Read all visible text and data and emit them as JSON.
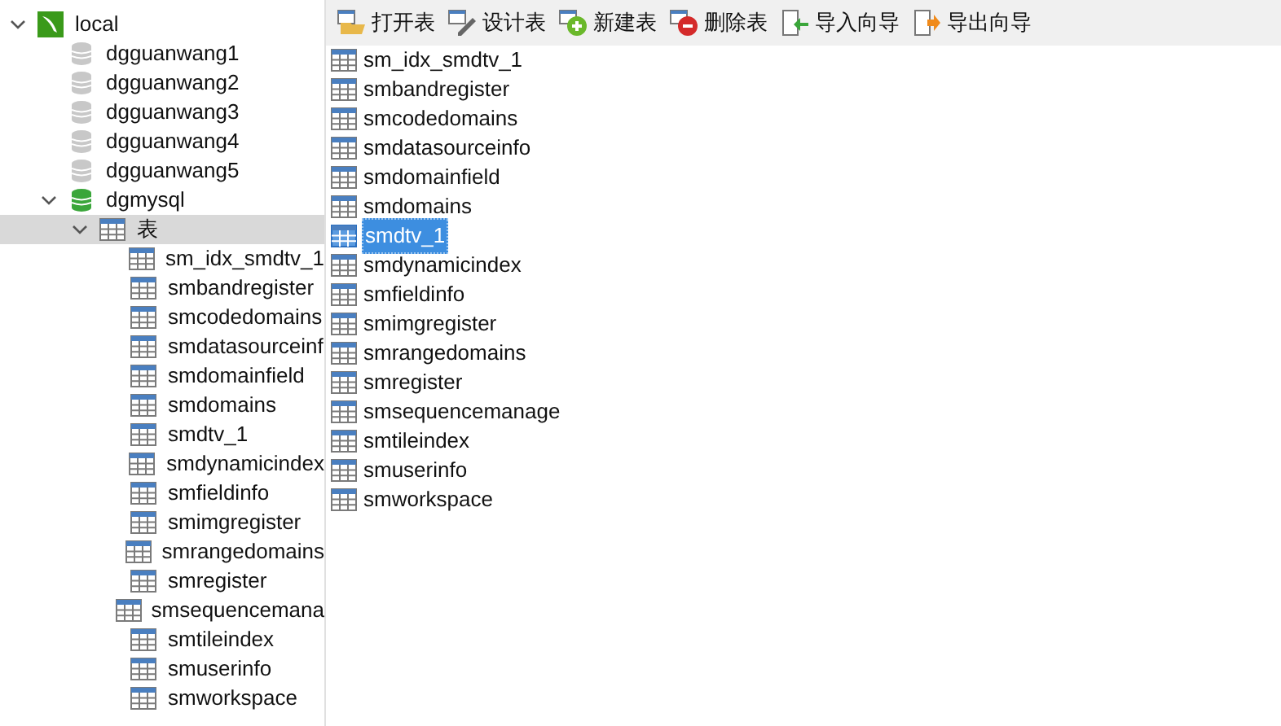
{
  "tree": [
    {
      "label": "local",
      "kind": "connection",
      "expanded": true,
      "children": [
        {
          "label": "dgguanwang1",
          "kind": "database",
          "open": false
        },
        {
          "label": "dgguanwang2",
          "kind": "database",
          "open": false
        },
        {
          "label": "dgguanwang3",
          "kind": "database",
          "open": false
        },
        {
          "label": "dgguanwang4",
          "kind": "database",
          "open": false
        },
        {
          "label": "dgguanwang5",
          "kind": "database",
          "open": false
        },
        {
          "label": "dgmysql",
          "kind": "database",
          "open": true,
          "expanded": true,
          "children": [
            {
              "label": "表",
              "kind": "folder",
              "expanded": true,
              "selected": true,
              "children": [
                {
                  "label": "sm_idx_smdtv_1",
                  "kind": "table"
                },
                {
                  "label": "smbandregister",
                  "kind": "table"
                },
                {
                  "label": "smcodedomains",
                  "kind": "table"
                },
                {
                  "label": "smdatasourceinf",
                  "kind": "table"
                },
                {
                  "label": "smdomainfield",
                  "kind": "table"
                },
                {
                  "label": "smdomains",
                  "kind": "table"
                },
                {
                  "label": "smdtv_1",
                  "kind": "table"
                },
                {
                  "label": "smdynamicindex",
                  "kind": "table"
                },
                {
                  "label": "smfieldinfo",
                  "kind": "table"
                },
                {
                  "label": "smimgregister",
                  "kind": "table"
                },
                {
                  "label": "smrangedomains",
                  "kind": "table"
                },
                {
                  "label": "smregister",
                  "kind": "table"
                },
                {
                  "label": "smsequencemana",
                  "kind": "table"
                },
                {
                  "label": "smtileindex",
                  "kind": "table"
                },
                {
                  "label": "smuserinfo",
                  "kind": "table"
                },
                {
                  "label": "smworkspace",
                  "kind": "table"
                }
              ]
            }
          ]
        }
      ]
    }
  ],
  "toolbar": [
    {
      "label": "打开表",
      "kind": "open"
    },
    {
      "label": "设计表",
      "kind": "design"
    },
    {
      "label": "新建表",
      "kind": "new"
    },
    {
      "label": "删除表",
      "kind": "delete"
    },
    {
      "label": "导入向导",
      "kind": "import"
    },
    {
      "label": "导出向导",
      "kind": "export"
    }
  ],
  "tables": [
    {
      "label": "sm_idx_smdtv_1",
      "selected": false
    },
    {
      "label": "smbandregister",
      "selected": false
    },
    {
      "label": "smcodedomains",
      "selected": false
    },
    {
      "label": "smdatasourceinfo",
      "selected": false
    },
    {
      "label": "smdomainfield",
      "selected": false
    },
    {
      "label": "smdomains",
      "selected": false
    },
    {
      "label": "smdtv_1",
      "selected": true
    },
    {
      "label": "smdynamicindex",
      "selected": false
    },
    {
      "label": "smfieldinfo",
      "selected": false
    },
    {
      "label": "smimgregister",
      "selected": false
    },
    {
      "label": "smrangedomains",
      "selected": false
    },
    {
      "label": "smregister",
      "selected": false
    },
    {
      "label": "smsequencemanage",
      "selected": false
    },
    {
      "label": "smtileindex",
      "selected": false
    },
    {
      "label": "smuserinfo",
      "selected": false
    },
    {
      "label": "smworkspace",
      "selected": false
    }
  ]
}
